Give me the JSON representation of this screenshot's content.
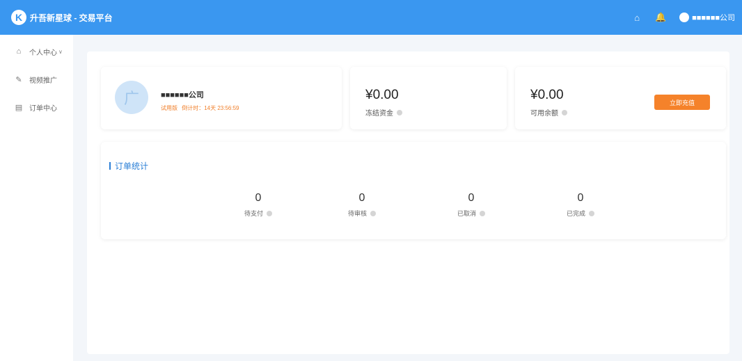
{
  "header": {
    "logo_char": "K",
    "title": "升吾新星球 - 交易平台",
    "home_icon": "⌂",
    "bell_icon": "🔔",
    "user_name": "■■■■■■公司"
  },
  "sidebar": {
    "items": [
      {
        "label": "个人中心",
        "icon": "⌂",
        "chevron": "∨"
      },
      {
        "label": "视频推广",
        "icon": "✎"
      },
      {
        "label": "订单中心",
        "icon": "▤"
      }
    ]
  },
  "profile": {
    "avatar_char": "广",
    "company": "■■■■■■公司",
    "trial_label": "试用版",
    "countdown": "倒计时：14天 23:56:59"
  },
  "frozen": {
    "amount": "¥0.00",
    "label": "冻结资金"
  },
  "available": {
    "amount": "¥0.00",
    "label": "可用余额",
    "button": "立即充值"
  },
  "orders": {
    "title": "订单统计",
    "stats": [
      {
        "value": "0",
        "label": "待支付"
      },
      {
        "value": "0",
        "label": "待审核"
      },
      {
        "value": "0",
        "label": "已取消"
      },
      {
        "value": "0",
        "label": "已完成"
      }
    ]
  },
  "colors": {
    "brand": "#3a97f0",
    "accent": "#f5822a",
    "title": "#2b7fd6"
  }
}
